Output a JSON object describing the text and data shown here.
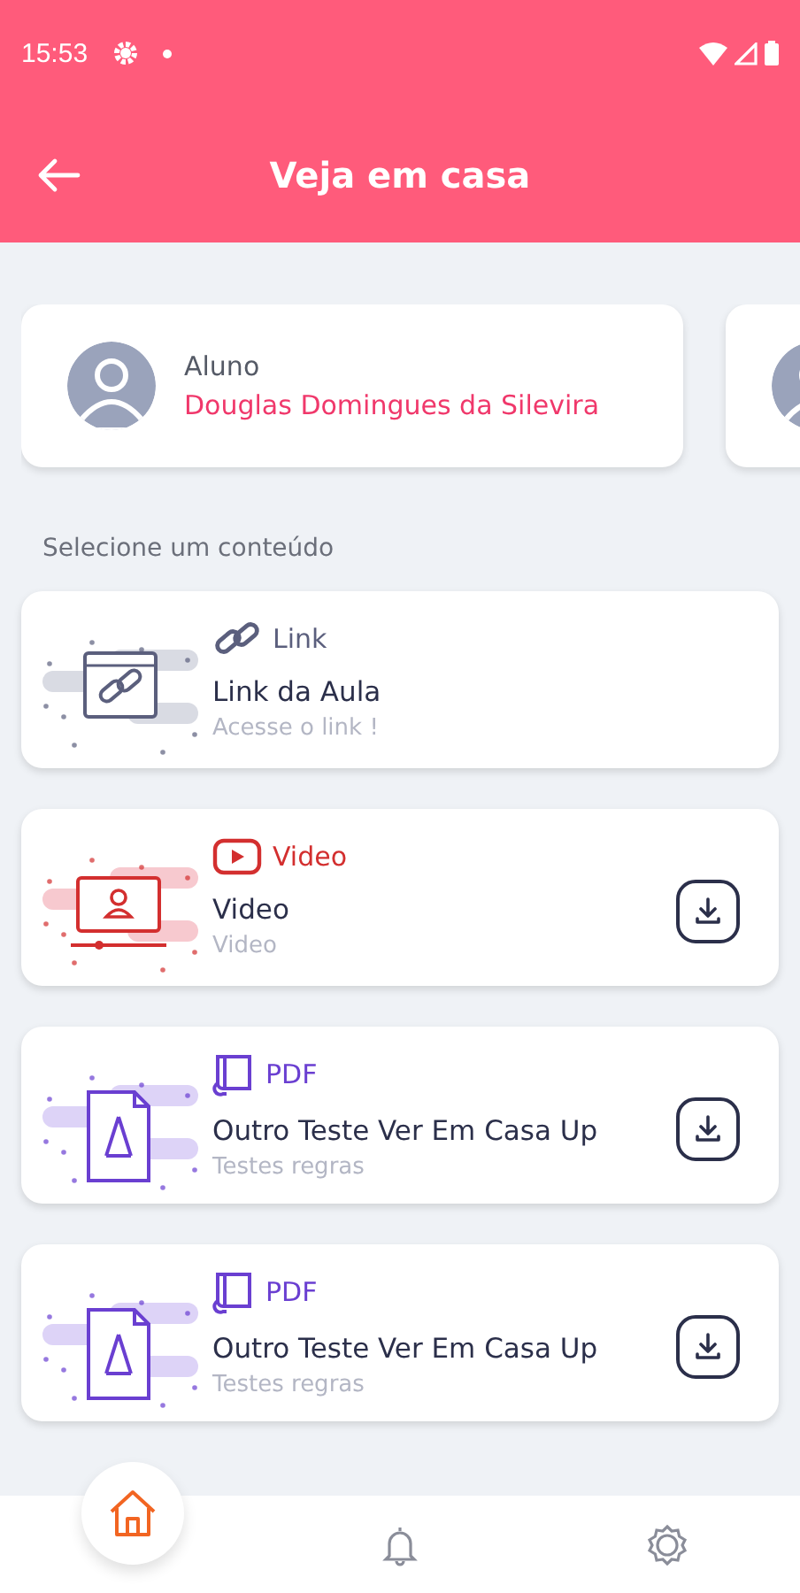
{
  "status_bar": {
    "time": "15:53"
  },
  "header": {
    "title": "Veja em casa"
  },
  "students": [
    {
      "kind": "full",
      "label": "Aluno",
      "name": "Douglas Domingues da Silevira"
    },
    {
      "kind": "cut"
    }
  ],
  "section_label": "Selecione um conteúdo",
  "contents": [
    {
      "kind": "link",
      "type_label": "Link",
      "title": "Link da Aula",
      "subtitle": "Acesse o link !",
      "downloadable": false
    },
    {
      "kind": "video",
      "type_label": "Video",
      "title": "Video",
      "subtitle": "Video",
      "downloadable": true
    },
    {
      "kind": "pdf",
      "type_label": "PDF",
      "title": "Outro Teste Ver Em Casa Up",
      "subtitle": "Testes regras",
      "downloadable": true
    },
    {
      "kind": "pdf",
      "type_label": "PDF",
      "title": "Outro Teste Ver Em Casa Up",
      "subtitle": "Testes regras",
      "downloadable": true
    }
  ],
  "nav": [
    {
      "kind": "home",
      "selected": true
    },
    {
      "kind": "bell",
      "selected": false
    },
    {
      "kind": "settings",
      "selected": false
    }
  ]
}
